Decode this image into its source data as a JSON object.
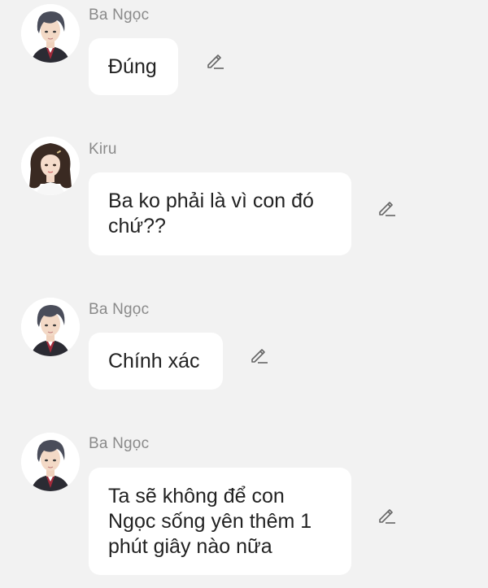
{
  "messages": [
    {
      "sender": "Ba Ngọc",
      "avatar": "male-character-avatar",
      "text": "Đúng"
    },
    {
      "sender": "Kiru",
      "avatar": "female-character-avatar",
      "text": "Ba ko phải là vì con đó\nchứ??"
    },
    {
      "sender": "Ba Ngọc",
      "avatar": "male-character-avatar",
      "text": "Chính xác"
    },
    {
      "sender": "Ba Ngọc",
      "avatar": "male-character-avatar",
      "text": "Ta sẽ không để con\nNgọc sống yên thêm 1\nphút giây nào nữa"
    }
  ],
  "icons": {
    "edit": "pencil-edit-icon"
  },
  "colors": {
    "background": "#f2f2f2",
    "bubble": "#ffffff",
    "sender_name": "#8a8a8a",
    "text": "#222222"
  }
}
